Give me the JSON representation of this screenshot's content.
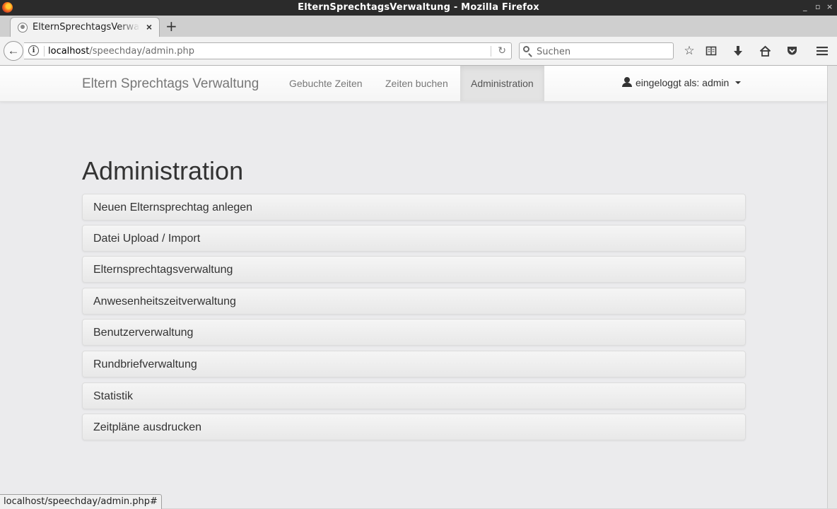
{
  "window": {
    "title": "ElternSprechtagsVerwaltung - Mozilla Firefox",
    "controls": [
      "_",
      "▫",
      "×"
    ]
  },
  "browser": {
    "tab_title": "ElternSprechtagsVerwaltung - Mozilla Firefox",
    "tab_close": "×",
    "new_tab": "+",
    "url_host": "localhost",
    "url_path": "/speechday/admin.php",
    "search_placeholder": "Suchen",
    "toolbar_icons": [
      "star-icon",
      "reading-list-icon",
      "download-icon",
      "home-icon",
      "pocket-icon",
      "menu-icon"
    ]
  },
  "app": {
    "brand": "Eltern Sprechtags Verwaltung",
    "nav": [
      {
        "label": "Gebuchte Zeiten",
        "active": false
      },
      {
        "label": "Zeiten buchen",
        "active": false
      },
      {
        "label": "Administration",
        "active": true
      }
    ],
    "user_label": "eingeloggt als: admin"
  },
  "page": {
    "title": "Administration",
    "panels": [
      "Neuen Elternsprechtag anlegen",
      "Datei Upload / Import",
      "Elternsprechtagsverwaltung",
      "Anwesenheitszeitverwaltung",
      "Benutzerverwaltung",
      "Rundbriefverwaltung",
      "Statistik",
      "Zeitpläne ausdrucken"
    ]
  },
  "status": {
    "link": "localhost/speechday/admin.php#"
  }
}
